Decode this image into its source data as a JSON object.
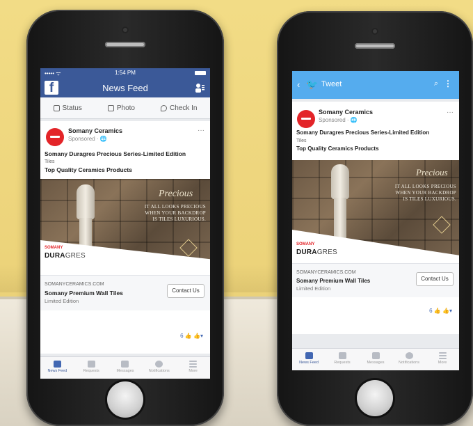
{
  "facebook": {
    "status_time": "1:54 PM",
    "status_carrier": "••••• ᯤ",
    "title": "News Feed",
    "actions": [
      "Status",
      "Photo",
      "Check In"
    ],
    "post": {
      "page": "Somany Ceramics",
      "sponsored": "Sponsored · 🌐",
      "more": "···",
      "line1": "Somany Duragres Precious Series-Limited Edition",
      "line2": "Tiles",
      "line3": "Top Quality Ceramics Products",
      "ad_overlay": "IT ALL LOOKS PRECIOUS\nWHEN YOUR BACKDROP\nIS TILES LUXURIOUS.",
      "ad_script": "Precious",
      "brand_small": "SOMANY",
      "brand_big": "DURA",
      "brand_suffix": "GRES",
      "cta_url": "SOMANYCERAMICS.COM",
      "cta_title": "Somany Premium Wall Tiles",
      "cta_sub": "Limited Edition",
      "cta_button": "Contact Us",
      "reactions": "6"
    },
    "tabs": [
      "News Feed",
      "Requests",
      "Messages",
      "Notifications",
      "More"
    ]
  },
  "twitter": {
    "back": "‹",
    "title": "Tweet",
    "post": {
      "page": "Somany Ceramics",
      "sponsored": "Sponsored · 🌐",
      "more": "···",
      "line1": "Somany Duragres Precious Series-Limited Edition",
      "line2": "Tiles",
      "line3": "Top Quality Ceramics Products",
      "ad_overlay": "IT ALL LOOKS PRECIOUS\nWHEN YOUR BACKDROP\nIS TILES LUXURIOUS.",
      "ad_script": "Precious",
      "brand_small": "SOMANY",
      "brand_big": "DURA",
      "brand_suffix": "GRES",
      "cta_url": "SOMANYCERAMICS.COM",
      "cta_title": "Somany Premium Wall Tiles",
      "cta_sub": "Limited Edition",
      "cta_button": "Contact Us",
      "reactions": "6"
    },
    "tabs": [
      "News Feed",
      "Requests",
      "Messages",
      "Notifications",
      "More"
    ]
  },
  "colors": {
    "facebook_blue": "#3b5998",
    "twitter_blue": "#55acee",
    "brand_red": "#e32428",
    "wall": "#ecd37a"
  }
}
